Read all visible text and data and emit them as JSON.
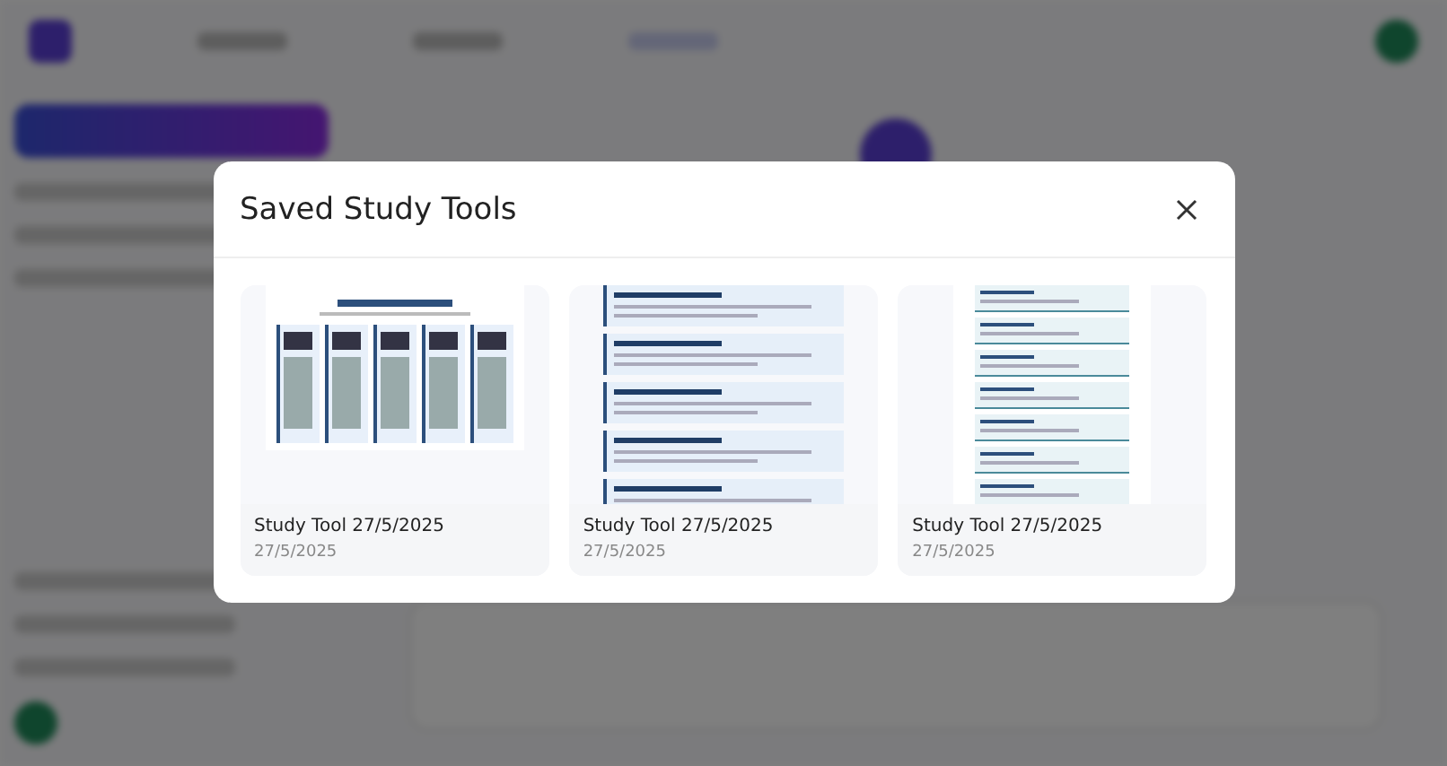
{
  "modal": {
    "title": "Saved Study Tools",
    "tools": [
      {
        "kind": "columns",
        "title": "Study Tool 27/5/2025",
        "date": "27/5/2025"
      },
      {
        "kind": "steps",
        "title": "Study Tool 27/5/2025",
        "date": "27/5/2025"
      },
      {
        "kind": "list",
        "title": "Study Tool 27/5/2025",
        "date": "27/5/2025"
      }
    ]
  }
}
